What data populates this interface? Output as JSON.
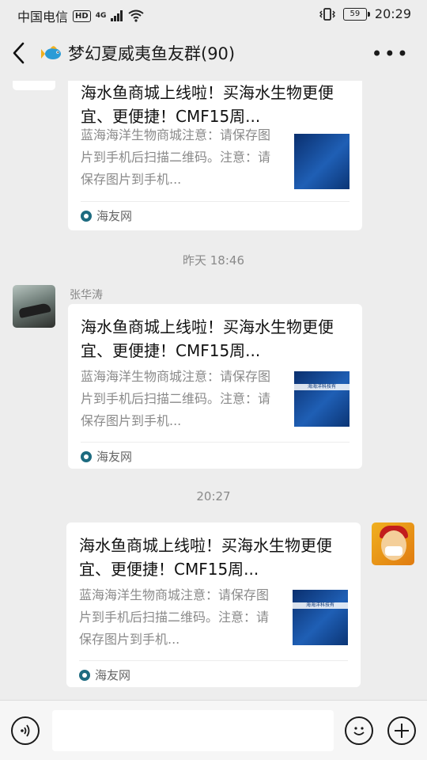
{
  "status_bar": {
    "carrier": "中国电信",
    "hd": "HD",
    "signal": "4G",
    "battery": "59",
    "time": "20:29"
  },
  "header": {
    "back_icon": "chevron-left-icon",
    "title": "梦幻夏威夷鱼友群(90)",
    "more_label": "•••"
  },
  "messages": [
    {
      "sender": "",
      "title": "海水鱼商城上线啦！买海水生物更便宜、更便捷！CMF15周...",
      "desc": "蓝海海洋生物商城注意：请保存图片到手机后扫描二维码。注意：请保存图片到手机...",
      "source": "海友网"
    },
    {
      "timestamp": "昨天 18:46",
      "sender": "张华涛",
      "title": "海水鱼商城上线啦！买海水生物更便宜、更便捷！CMF15周...",
      "desc": "蓝海海洋生物商城注意：请保存图片到手机后扫描二维码。注意：请保存图片到手机...",
      "source": "海友网",
      "thumb_text": "海海洋科技有"
    },
    {
      "timestamp": "20:27",
      "sender": "",
      "title": "海水鱼商城上线啦！买海水生物更便宜、更便捷！CMF15周...",
      "desc": "蓝海海洋生物商城注意：请保存图片到手机后扫描二维码。注意：请保存图片到手机...",
      "source": "海友网",
      "thumb_text": "海海洋科技有"
    }
  ],
  "input_bar": {
    "voice_icon": "voice-icon",
    "emoji_icon": "emoji-icon",
    "plus_icon": "plus-icon"
  },
  "colors": {
    "background": "#ededed",
    "card": "#ffffff",
    "secondary_text": "#8a8a8a"
  }
}
